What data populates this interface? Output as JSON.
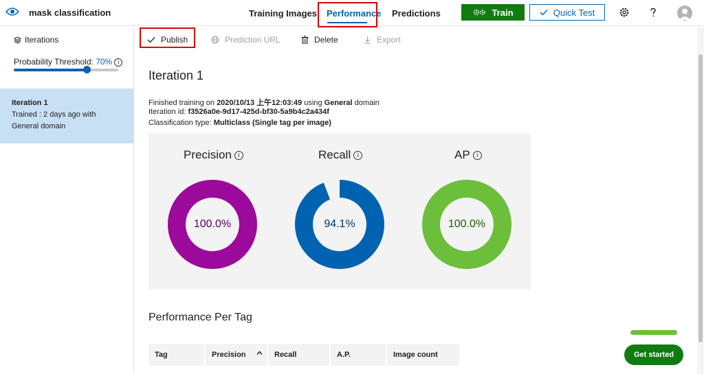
{
  "header": {
    "app_title": "mask classification",
    "tabs": [
      {
        "label": "Training Images"
      },
      {
        "label": "Performance"
      },
      {
        "label": "Predictions"
      }
    ],
    "train_label": "Train",
    "quick_test_label": "Quick Test",
    "accent_color": "#0063b1",
    "train_color": "#107c10"
  },
  "sidebar": {
    "iterations_label": "Iterations",
    "threshold_label": "Probability Threshold: ",
    "threshold_value": "70%",
    "threshold_fraction": 0.7,
    "iteration": {
      "name": "Iteration 1",
      "line1": "Trained : 2 days ago with",
      "line2": "General domain"
    }
  },
  "toolbar": {
    "publish": "Publish",
    "prediction_url": "Prediction URL",
    "delete": "Delete",
    "export": "Export"
  },
  "main": {
    "title": "Iteration 1",
    "finished_prefix": "Finished training on ",
    "finished_date": "2020/10/13 上午12:03:49",
    "finished_mid": " using ",
    "finished_domain": "General",
    "finished_suffix": " domain",
    "iteration_id_prefix": "Iteration id: ",
    "iteration_id": "f3526a0e-9d17-425d-bf30-5a9b4c2a434f",
    "classification_prefix": "Classification type: ",
    "classification_type": "Multiclass (Single tag per image)"
  },
  "metrics": [
    {
      "label": "Precision",
      "value_text": "100.0%",
      "fraction": 1.0,
      "color": "#9b0a9b",
      "text_color": "#5c005c"
    },
    {
      "label": "Recall",
      "value_text": "94.1%",
      "fraction": 0.941,
      "color": "#0063b1",
      "text_color": "#003966"
    },
    {
      "label": "AP",
      "value_text": "100.0%",
      "fraction": 1.0,
      "color": "#6bbf3b",
      "text_color": "#1e5a00"
    }
  ],
  "per_tag": {
    "title": "Performance Per Tag",
    "columns": [
      "Tag",
      "Precision",
      "Recall",
      "A.P.",
      "Image count"
    ]
  },
  "get_started": "Get started"
}
